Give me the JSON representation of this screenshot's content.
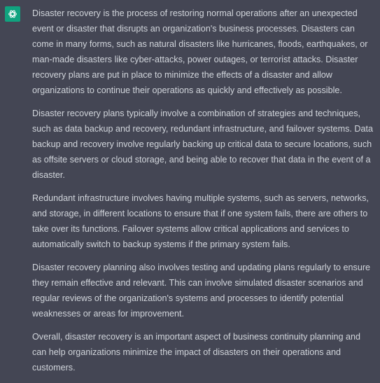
{
  "message": {
    "avatar_icon": "openai-logo-icon",
    "colors": {
      "background": "#444654",
      "text": "#d1d5db",
      "avatar_bg": "#10a37f"
    },
    "paragraphs": [
      "Disaster recovery is the process of restoring normal operations after an unexpected event or disaster that disrupts an organization's business processes. Disasters can come in many forms, such as natural disasters like hurricanes, floods, earthquakes, or man-made disasters like cyber-attacks, power outages, or terrorist attacks. Disaster recovery plans are put in place to minimize the effects of a disaster and allow organizations to continue their operations as quickly and effectively as possible.",
      "Disaster recovery plans typically involve a combination of strategies and techniques, such as data backup and recovery, redundant infrastructure, and failover systems. Data backup and recovery involve regularly backing up critical data to secure locations, such as offsite servers or cloud storage, and being able to recover that data in the event of a disaster.",
      "Redundant infrastructure involves having multiple systems, such as servers, networks, and storage, in different locations to ensure that if one system fails, there are others to take over its functions. Failover systems allow critical applications and services to automatically switch to backup systems if the primary system fails.",
      "Disaster recovery planning also involves testing and updating plans regularly to ensure they remain effective and relevant. This can involve simulated disaster scenarios and regular reviews of the organization's systems and processes to identify potential weaknesses or areas for improvement.",
      "Overall, disaster recovery is an important aspect of business continuity planning and can help organizations minimize the impact of disasters on their operations and customers."
    ]
  }
}
